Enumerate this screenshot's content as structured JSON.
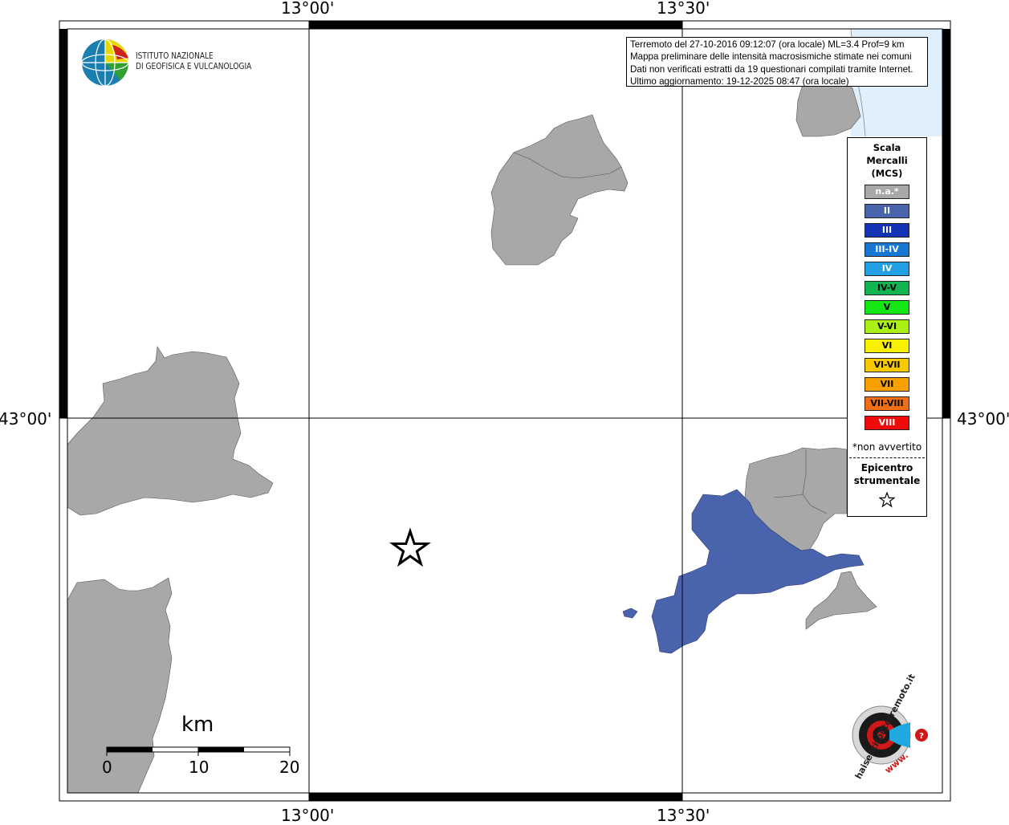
{
  "map": {
    "lon_labels": [
      "13°00'",
      "13°30'"
    ],
    "lat_labels": [
      "43°00'"
    ],
    "colors": {
      "not_felt": "#a8a8a8",
      "intensity_II": "#4a63ad",
      "sea": "#dff0fc"
    }
  },
  "info": {
    "line1": "Terremoto del 27-10-2016 09:12:07 (ora locale) ML=3.4 Prof=9 km",
    "line2": "Mappa preliminare delle intensità macrosismiche stimate nei comuni",
    "line3": "Dati non verificati estratti da 19 questionari compilati tramite Internet.",
    "line4": "Ultimo aggiornamento: 19-12-2025 08:47 (ora locale)"
  },
  "legend": {
    "title_lines": [
      "Scala",
      "Mercalli",
      "(MCS)"
    ],
    "items": [
      {
        "label": "n.a.*",
        "color": "#a8a8a8",
        "text_color": "#ffffff"
      },
      {
        "label": "II",
        "color": "#4a63ad",
        "text_color": "#ffffff"
      },
      {
        "label": "III",
        "color": "#1432b4",
        "text_color": "#ffffff"
      },
      {
        "label": "III-IV",
        "color": "#1678d2",
        "text_color": "#ffffff"
      },
      {
        "label": "IV",
        "color": "#22a0e6",
        "text_color": "#ffffff"
      },
      {
        "label": "IV-V",
        "color": "#12b450",
        "text_color": "#000000"
      },
      {
        "label": "V",
        "color": "#14e614",
        "text_color": "#000000"
      },
      {
        "label": "V-VI",
        "color": "#aaf014",
        "text_color": "#000000"
      },
      {
        "label": "VI",
        "color": "#f8f000",
        "text_color": "#000000"
      },
      {
        "label": "VI-VII",
        "color": "#f8c800",
        "text_color": "#000000"
      },
      {
        "label": "VII",
        "color": "#f8a000",
        "text_color": "#000000"
      },
      {
        "label": "VII-VIII",
        "color": "#f06e14",
        "text_color": "#000000"
      },
      {
        "label": "VIII",
        "color": "#f00a0a",
        "text_color": "#ffffff"
      }
    ],
    "note": "*non avvertito",
    "epicenter_lines": [
      "Epicentro",
      "strumentale"
    ]
  },
  "logo": {
    "ingv_lines": [
      "ISTITUTO NAZIONALE",
      "DI GEOFISICA E VULCANOLOGIA"
    ],
    "hsit_text": "haisentitoilterremoto.it",
    "hsit_www": "www."
  },
  "scale_bar": {
    "unit": "km",
    "ticks": [
      "0",
      "10",
      "20"
    ]
  }
}
